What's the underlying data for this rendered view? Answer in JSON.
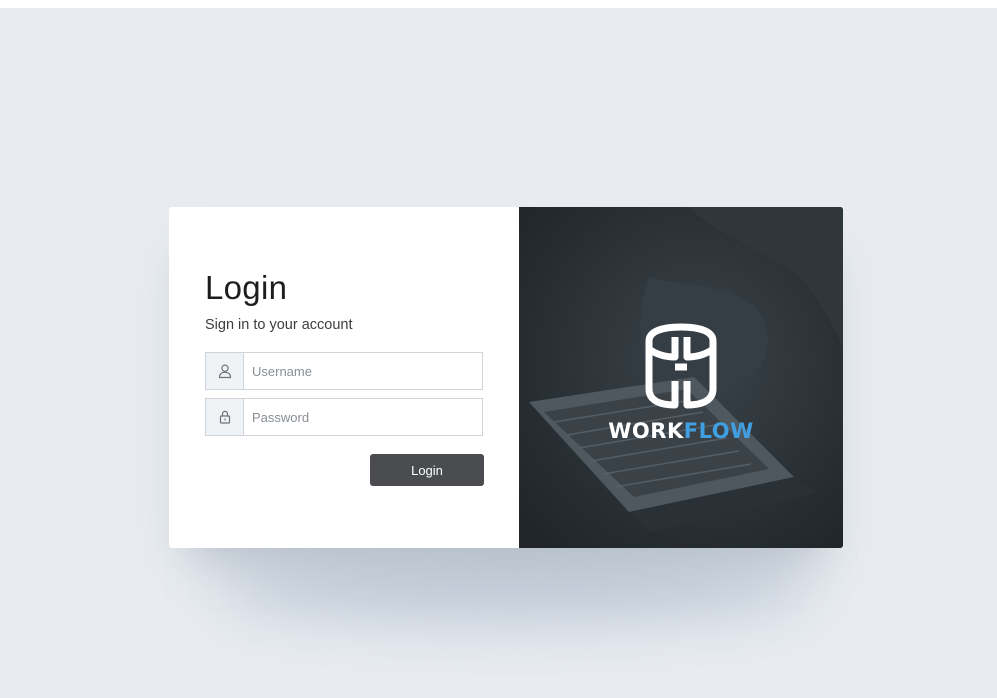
{
  "login": {
    "title": "Login",
    "subtitle": "Sign in to your account",
    "username_placeholder": "Username",
    "password_placeholder": "Password",
    "button_label": "Login"
  },
  "brand": {
    "word1": "WORK",
    "word2": "FLOW",
    "accent_color": "#3f9fe0"
  },
  "icons": {
    "username": "user-icon",
    "password": "lock-icon"
  },
  "colors": {
    "background": "#e8ecf1",
    "button": "#4a4c4f",
    "brand_panel": "#262c31"
  }
}
